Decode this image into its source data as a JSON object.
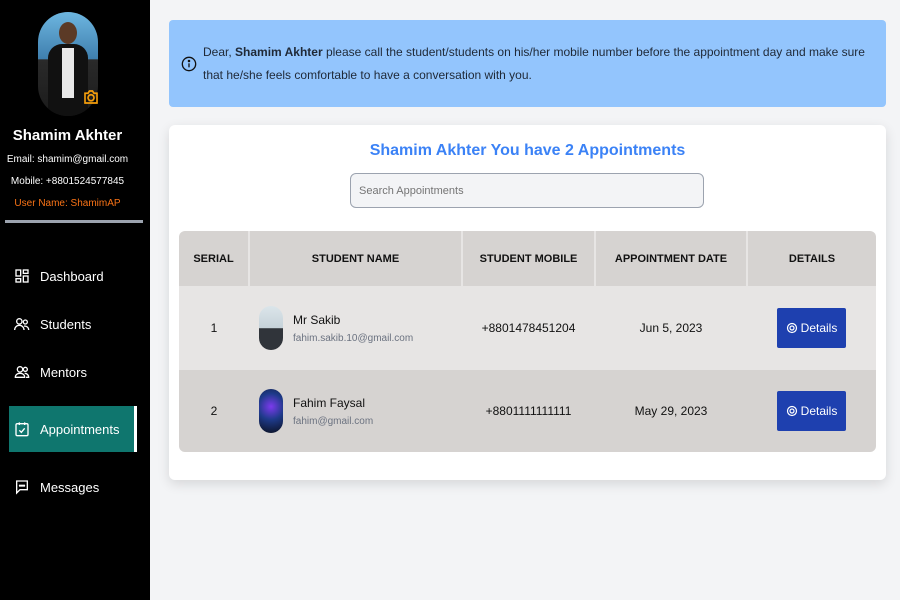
{
  "profile": {
    "name": "Shamim Akhter",
    "email": "Email: shamim@gmail.com",
    "mobile": "Mobile: +8801524577845",
    "username": "User Name: ShamimAP"
  },
  "nav": {
    "items": [
      {
        "label": "Dashboard",
        "icon": "dashboard-icon"
      },
      {
        "label": "Students",
        "icon": "users-icon"
      },
      {
        "label": "Mentors",
        "icon": "mentors-icon"
      },
      {
        "label": "Appointments",
        "icon": "calendar-check-icon",
        "active": true
      },
      {
        "label": "Messages",
        "icon": "message-icon"
      }
    ]
  },
  "banner": {
    "prefix": "Dear,",
    "name": "Shamim Akhter",
    "text": "please call the student/students on his/her mobile number before the appointment day and make sure that he/she feels comfortable to have a conversation with you."
  },
  "appointments": {
    "title": "Shamim Akhter You have 2 Appointments",
    "search_placeholder": "Search Appointments",
    "columns": [
      "SERIAL",
      "STUDENT NAME",
      "STUDENT MOBILE",
      "APPOINTMENT DATE",
      "DETAILS"
    ],
    "rows": [
      {
        "serial": "1",
        "name": "Mr Sakib",
        "email": "fahim.sakib.10@gmail.com",
        "mobile": "+8801478451204",
        "date": "Jun 5, 2023",
        "details": "Details"
      },
      {
        "serial": "2",
        "name": "Fahim Faysal",
        "email": "fahim@gmail.com",
        "mobile": "+8801111111111",
        "date": "May 29, 2023",
        "details": "Details"
      }
    ]
  },
  "colors": {
    "sidebar_bg": "#000000",
    "active_nav": "#0f766e",
    "banner_bg": "#93c5fd",
    "title_blue": "#3b82f6",
    "button_blue": "#1e40af",
    "username_orange": "#f97316"
  }
}
